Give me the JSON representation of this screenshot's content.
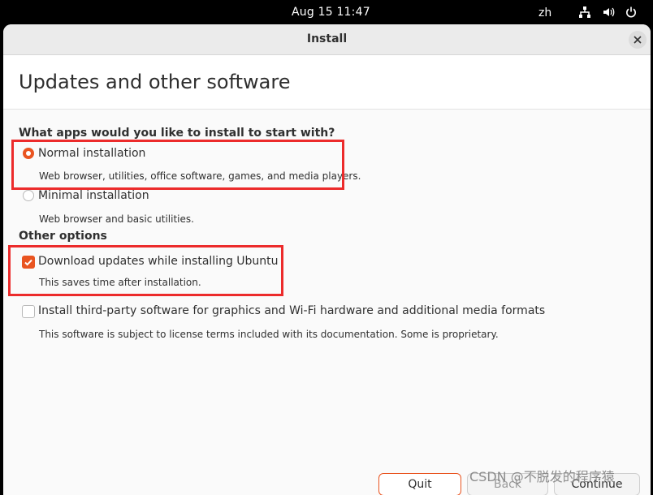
{
  "topbar": {
    "clock": "Aug 15  11:47",
    "language": "zh",
    "icons": [
      "network-icon",
      "volume-icon",
      "power-icon"
    ]
  },
  "window": {
    "title": "Install",
    "page_title": "Updates and other software",
    "close_icon": "close-icon"
  },
  "apps_section": {
    "title": "What apps would you like to install to start with?",
    "options": [
      {
        "label": "Normal installation",
        "description": "Web browser, utilities, office software, games, and media players.",
        "selected": true
      },
      {
        "label": "Minimal installation",
        "description": "Web browser and basic utilities.",
        "selected": false
      }
    ]
  },
  "other_section": {
    "title": "Other options",
    "options": [
      {
        "label": "Download updates while installing Ubuntu",
        "description": "This saves time after installation.",
        "checked": true
      },
      {
        "label": "Install third-party software for graphics and Wi-Fi hardware and additional media formats",
        "description": "This software is subject to license terms included with its documentation. Some is proprietary.",
        "checked": false
      }
    ]
  },
  "buttons": {
    "quit": "Quit",
    "back": "Back",
    "continue": "Continue"
  },
  "watermark": "CSDN @不脱发的程序猿",
  "colors": {
    "accent": "#e95420",
    "highlight": "#ec2b2b"
  }
}
